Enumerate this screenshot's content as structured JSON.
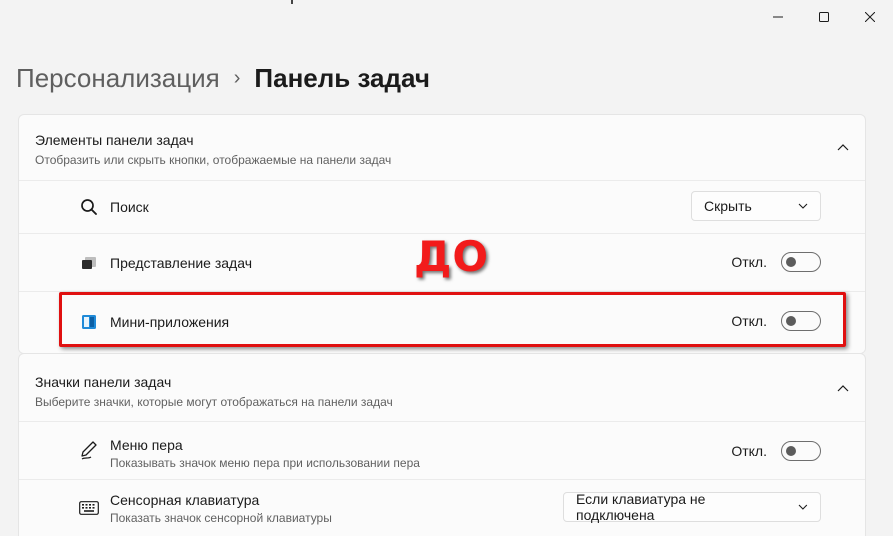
{
  "window": {
    "controls": [
      "minimize",
      "maximize",
      "close"
    ]
  },
  "breadcrumb": {
    "parent": "Персонализация",
    "separator": "›",
    "current": "Панель задач"
  },
  "taskbar_items": {
    "title": "Элементы панели задач",
    "description": "Отобразить или скрыть кнопки, отображаемые на панели задач",
    "rows": [
      {
        "icon": "search-icon",
        "label": "Поиск",
        "control": "dropdown",
        "value": "Скрыть"
      },
      {
        "icon": "task-view-icon",
        "label": "Представление задач",
        "control": "toggle",
        "state_label": "Откл.",
        "on": false
      },
      {
        "icon": "widgets-icon",
        "label": "Мини-приложения",
        "control": "toggle",
        "state_label": "Откл.",
        "on": false
      }
    ]
  },
  "taskbar_icons": {
    "title": "Значки панели задач",
    "description": "Выберите значки, которые могут отображаться на панели задач",
    "rows": [
      {
        "icon": "pen-icon",
        "label": "Меню пера",
        "sublabel": "Показывать значок меню пера при использовании пера",
        "control": "toggle",
        "state_label": "Откл.",
        "on": false
      },
      {
        "icon": "keyboard-icon",
        "label": "Сенсорная клавиатура",
        "sublabel": "Показать значок сенсорной клавиатуры",
        "control": "dropdown",
        "value": "Если клавиатура не подключена"
      }
    ]
  },
  "annotation": {
    "text": "ДО",
    "color": "#f21b1b"
  },
  "colors": {
    "background": "#f3f3f3",
    "card": "#fbfbfb",
    "highlight": "#e01010"
  }
}
